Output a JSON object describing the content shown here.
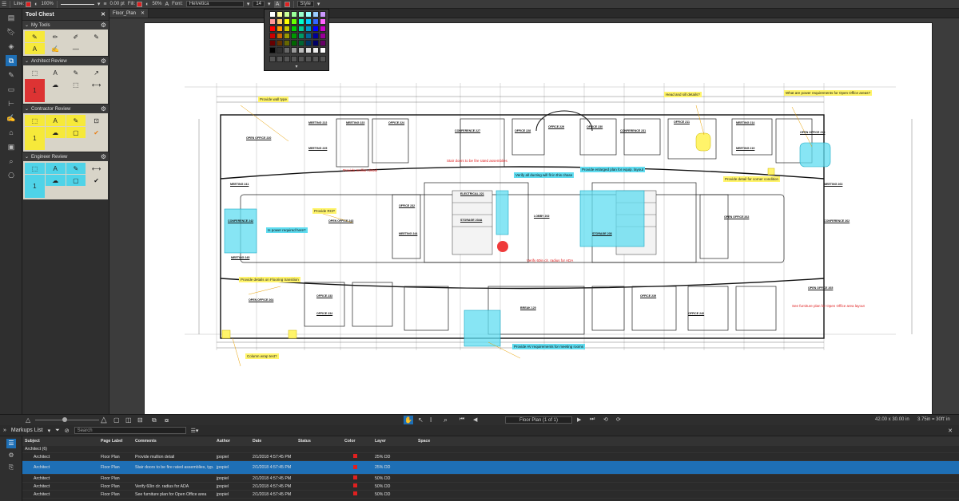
{
  "toolbar": {
    "line_label": "Line:",
    "opacity": "100%",
    "line_width": "0.00 pt",
    "fill_label": "Fill:",
    "fill_opacity": "50%",
    "font_label": "Font:",
    "font_name": "Helvetica",
    "font_size": "14",
    "style_label": "Style",
    "line_color": "#e02020",
    "text_color": "#e02020"
  },
  "tool_chest": {
    "title": "Tool Chest",
    "sections": [
      {
        "label": "My Tools"
      },
      {
        "label": "Architect Review"
      },
      {
        "label": "Contractor Review"
      },
      {
        "label": "Engineer Review"
      }
    ]
  },
  "document": {
    "tab": "Floor_Plan",
    "rooms": [
      "OPEN OFFICE 220",
      "MEETING 222",
      "MEETING 223",
      "OFFICE 224",
      "MEETING 225",
      "CONFERENCE 227",
      "OFFICE 228",
      "OFFICE 229",
      "OFFICE 230",
      "CONFERENCE 231",
      "OFFICE 211",
      "MEETING 214",
      "OPEN OFFICE 218",
      "MEETING 219",
      "MEETING 241",
      "CONFERENCE 242",
      "OPEN OFFICE 243",
      "MEETING 245",
      "OFFICE 232",
      "MEETING 244",
      "CONFERENCE 262",
      "OPEN OFFICE 262",
      "MEETING 263",
      "ELECTRICAL 221",
      "STORAGE 234A",
      "LOBBY 202",
      "STORAGE 236",
      "BREAK 120",
      "OFFICE 233",
      "OFFICE 234",
      "OFFICE 239",
      "OFFICE 240",
      "OPEN OFFICE 264",
      "OPEN OFFICE 265"
    ],
    "annotations": {
      "wall_type": "Provide wall type",
      "head_sill": "Head and sill details?",
      "power_req": "What are power requirements for Open Office areas?",
      "mullion": "Provide mullion detail",
      "rcp": "Provide RCP",
      "power_here": "Is power required here?",
      "duct": "Verify all ducting will fit in this chase",
      "equip": "Provide enlarged plan for equip. layout",
      "corner": "Provide detail for corner condition",
      "ada": "Verify 60in clr. radius for ADA",
      "flooring": "Provide details on Flooring transition",
      "furniture": "See furniture plan for Open Office area layout",
      "column_wrap": "Column wrap test?",
      "av_req": "Provide AV requirements for meeting rooms",
      "stair": "Stair doors to be fire rated assemblies"
    }
  },
  "status": {
    "page": "Floor Plan (1 of 1)",
    "size": "42.00 x 30.00 in",
    "scale": "3.75in = 30ft' in"
  },
  "markups": {
    "title": "Markups List",
    "search_placeholder": "Search",
    "columns": [
      "Subject",
      "Page Label",
      "Comments",
      "Author",
      "Date",
      "Status",
      "Color",
      "Layer",
      "Space"
    ],
    "group": "Architect (6)",
    "rows": [
      {
        "subject": "Architect",
        "page": "Floor Plan",
        "comment": "Provide mullion detail",
        "author": "jpopiel",
        "date": "2/1/2018 4:57:45 PM",
        "layer": "25% DD"
      },
      {
        "subject": "Architect",
        "page": "Floor Plan",
        "comment": "Stair doors to be fire rated assemblies, typ.",
        "author": "jpopiel",
        "date": "2/1/2018 4:57:45 PM",
        "layer": "25% DD"
      },
      {
        "subject": "Architect",
        "page": "Floor Plan",
        "comment": "",
        "author": "jpopiel",
        "date": "2/1/2018 4:57:45 PM",
        "layer": "50% DD"
      },
      {
        "subject": "Architect",
        "page": "Floor Plan",
        "comment": "Verify 60in clr. radius for ADA",
        "author": "jpopiel",
        "date": "2/1/2018 4:57:45 PM",
        "layer": "50% DD"
      },
      {
        "subject": "Architect",
        "page": "Floor Plan",
        "comment": "See furniture plan for Open Office area",
        "author": "jpopiel",
        "date": "2/1/2018 4:57:45 PM",
        "layer": "50% DD"
      }
    ]
  }
}
